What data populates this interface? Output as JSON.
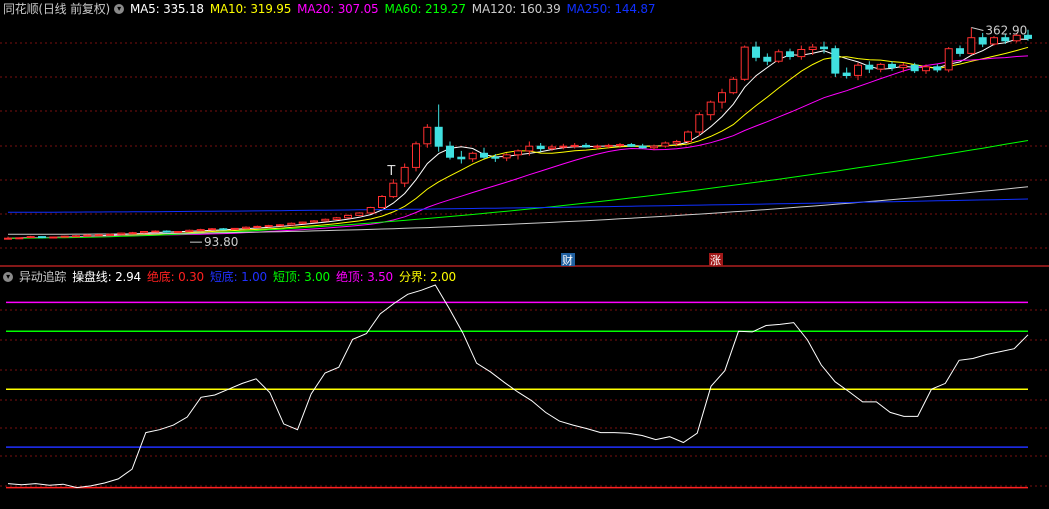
{
  "upper": {
    "title": "同花顺(日线 前复权)",
    "toggle_icon": "chevron-down-icon",
    "indicators": [
      {
        "label": "MA5:",
        "value": "335.18",
        "color": "#ffffff"
      },
      {
        "label": "MA10:",
        "value": "319.95",
        "color": "#ffff00"
      },
      {
        "label": "MA20:",
        "value": "307.05",
        "color": "#ff00ff"
      },
      {
        "label": "MA60:",
        "value": "219.27",
        "color": "#00ff00"
      },
      {
        "label": "MA120:",
        "value": "160.39",
        "color": "#cccccc"
      },
      {
        "label": "MA250:",
        "value": "144.87",
        "color": "#1030ff"
      }
    ],
    "high_label": "362.90",
    "low_label": "93.80",
    "markers": [
      "T",
      "财",
      "涨"
    ]
  },
  "lower": {
    "title": "异动追踪",
    "toggle_icon": "chevron-down-icon",
    "indicators": [
      {
        "label": "操盘线:",
        "value": "2.94",
        "color": "#ffffff"
      },
      {
        "label": "绝底:",
        "value": "0.30",
        "color": "#ff2020"
      },
      {
        "label": "短底:",
        "value": "1.00",
        "color": "#2030ff"
      },
      {
        "label": "短顶:",
        "value": "3.00",
        "color": "#00ff00"
      },
      {
        "label": "绝顶:",
        "value": "3.50",
        "color": "#ff00ff"
      },
      {
        "label": "分界:",
        "value": "2.00",
        "color": "#ffff00"
      }
    ]
  },
  "chart_data": [
    {
      "type": "candlestick",
      "title": "同花顺(日线 前复权)",
      "ylim": [
        80,
        375
      ],
      "up_color": "#ff3030",
      "down_color": "#40e0e0",
      "candles": [
        [
          94,
          97,
          93.8,
          95
        ],
        [
          95,
          96,
          94,
          95.5
        ],
        [
          96,
          98,
          95,
          97
        ],
        [
          97,
          97.5,
          95,
          96
        ],
        [
          96,
          97,
          95,
          96.5
        ],
        [
          96.5,
          98,
          96,
          97.5
        ],
        [
          97.5,
          99,
          97,
          98
        ],
        [
          98,
          100,
          97.5,
          99
        ],
        [
          99,
          100,
          98,
          99.5
        ],
        [
          99.5,
          101,
          99,
          100
        ],
        [
          100,
          102,
          99.5,
          101.5
        ],
        [
          101.5,
          103,
          101,
          102
        ],
        [
          102,
          104,
          101,
          103.5
        ],
        [
          103.5,
          105,
          103,
          104
        ],
        [
          104,
          105,
          102,
          103
        ],
        [
          103,
          104,
          102,
          103.5
        ],
        [
          103.5,
          106,
          103,
          105
        ],
        [
          105,
          107,
          104,
          106
        ],
        [
          106,
          108,
          105,
          107
        ],
        [
          107,
          108,
          106,
          106.5
        ],
        [
          106.5,
          108,
          106,
          107.5
        ],
        [
          107.5,
          110,
          107,
          109
        ],
        [
          109,
          111,
          108,
          110
        ],
        [
          110,
          112,
          109,
          111
        ],
        [
          111,
          113,
          110,
          112
        ],
        [
          112,
          115,
          111,
          114
        ],
        [
          114,
          116,
          113,
          115.5
        ],
        [
          115.5,
          118,
          115,
          117
        ],
        [
          117,
          120,
          116,
          119
        ],
        [
          119,
          122,
          118,
          121
        ],
        [
          121,
          125,
          120,
          124
        ],
        [
          124,
          128,
          123,
          127
        ],
        [
          127,
          135,
          126,
          134
        ],
        [
          134,
          150,
          133,
          148
        ],
        [
          148,
          170,
          146,
          165
        ],
        [
          165,
          190,
          160,
          185
        ],
        [
          185,
          218,
          180,
          215
        ],
        [
          215,
          240,
          210,
          236
        ],
        [
          236,
          265,
          205,
          212
        ],
        [
          212,
          218,
          195,
          198
        ],
        [
          198,
          206,
          190,
          196
        ],
        [
          196,
          205,
          192,
          203
        ],
        [
          203,
          210,
          196,
          198
        ],
        [
          198,
          202,
          192,
          197
        ],
        [
          197,
          203,
          193,
          201
        ],
        [
          201,
          208,
          195,
          206
        ],
        [
          206,
          218,
          200,
          212
        ],
        [
          212,
          216,
          205,
          209
        ],
        [
          209,
          214,
          206,
          211
        ],
        [
          211,
          215,
          208,
          212
        ],
        [
          212,
          216,
          209,
          213
        ],
        [
          213,
          216,
          210,
          211
        ],
        [
          211,
          214,
          208,
          212
        ],
        [
          212,
          215,
          209,
          213
        ],
        [
          213,
          216,
          210,
          214
        ],
        [
          214,
          216,
          211,
          212
        ],
        [
          212,
          215,
          209,
          210
        ],
        [
          210,
          214,
          207,
          212
        ],
        [
          212,
          218,
          210,
          216
        ],
        [
          216,
          220,
          212,
          218
        ],
        [
          218,
          232,
          215,
          230
        ],
        [
          230,
          255,
          225,
          252
        ],
        [
          252,
          270,
          245,
          268
        ],
        [
          268,
          285,
          260,
          280
        ],
        [
          280,
          300,
          278,
          297
        ],
        [
          297,
          340,
          295,
          338
        ],
        [
          338,
          345,
          320,
          325
        ],
        [
          325,
          330,
          315,
          320
        ],
        [
          320,
          335,
          318,
          332
        ],
        [
          332,
          336,
          322,
          326
        ],
        [
          326,
          340,
          322,
          335
        ],
        [
          335,
          342,
          328,
          338
        ],
        [
          338,
          345,
          330,
          336
        ],
        [
          336,
          340,
          300,
          305
        ],
        [
          305,
          312,
          298,
          302
        ],
        [
          302,
          318,
          296,
          315
        ],
        [
          315,
          320,
          305,
          310
        ],
        [
          310,
          318,
          306,
          316
        ],
        [
          316,
          320,
          308,
          312
        ],
        [
          312,
          318,
          306,
          315
        ],
        [
          315,
          318,
          305,
          308
        ],
        [
          308,
          316,
          304,
          313
        ],
        [
          313,
          316,
          306,
          309
        ],
        [
          309,
          338,
          306,
          336
        ],
        [
          336,
          340,
          326,
          330
        ],
        [
          330,
          362.9,
          328,
          350
        ],
        [
          350,
          356,
          338,
          342
        ],
        [
          342,
          352,
          340,
          350
        ],
        [
          350,
          355,
          342,
          346
        ],
        [
          346,
          356,
          344,
          353
        ],
        [
          353,
          360,
          346,
          349
        ]
      ],
      "ma_colors": {
        "MA5": "#ffffff",
        "MA10": "#ffff00",
        "MA20": "#ff00ff",
        "MA60": "#00ff00",
        "MA120": "#cccccc",
        "MA250": "#1030ff"
      }
    },
    {
      "type": "line",
      "title": "异动追踪",
      "ylim": [
        0,
        3.8
      ],
      "levels": [
        {
          "name": "绝顶",
          "value": 3.5,
          "color": "#ff00ff"
        },
        {
          "name": "短顶",
          "value": 3.0,
          "color": "#00ff00"
        },
        {
          "name": "分界",
          "value": 2.0,
          "color": "#ffff00"
        },
        {
          "name": "短底",
          "value": 1.0,
          "color": "#2030ff"
        },
        {
          "name": "绝底",
          "value": 0.3,
          "color": "#ff2020"
        }
      ],
      "series": [
        {
          "name": "操盘线",
          "color": "#ffffff",
          "values": [
            0.37,
            0.35,
            0.37,
            0.34,
            0.36,
            0.3,
            0.33,
            0.38,
            0.45,
            0.62,
            1.25,
            1.3,
            1.38,
            1.52,
            1.86,
            1.9,
            2.0,
            2.1,
            2.18,
            1.94,
            1.4,
            1.3,
            1.92,
            2.28,
            2.38,
            2.86,
            2.96,
            3.3,
            3.48,
            3.64,
            3.71,
            3.8,
            3.4,
            2.97,
            2.45,
            2.3,
            2.12,
            1.95,
            1.8,
            1.6,
            1.45,
            1.38,
            1.32,
            1.25,
            1.25,
            1.24,
            1.2,
            1.13,
            1.18,
            1.08,
            1.24,
            2.05,
            2.32,
            3.0,
            2.99,
            3.1,
            3.12,
            3.15,
            2.85,
            2.42,
            2.13,
            1.96,
            1.78,
            1.78,
            1.6,
            1.53,
            1.53,
            2.0,
            2.1,
            2.5,
            2.53,
            2.6,
            2.65,
            2.7,
            2.94
          ]
        }
      ]
    }
  ]
}
